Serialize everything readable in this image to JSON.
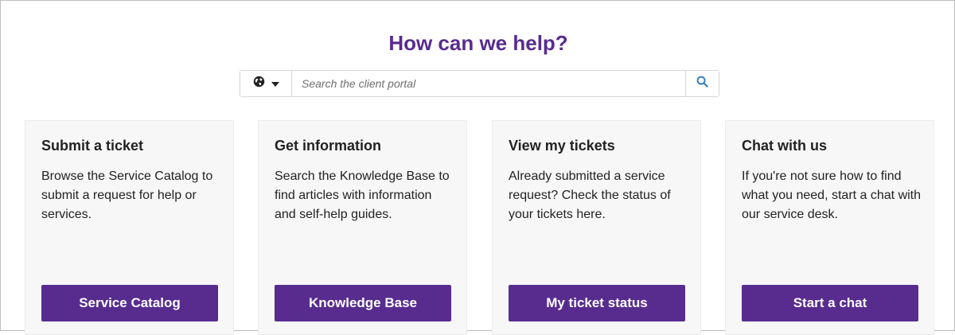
{
  "header": {
    "title": "How can we help?"
  },
  "search": {
    "placeholder": "Search the client portal",
    "language_icon": "globe-icon",
    "dropdown_icon": "caret-down-icon",
    "button_icon": "search-icon"
  },
  "cards": [
    {
      "title": "Submit a ticket",
      "description": "Browse the Service Catalog to submit a request for help or services.",
      "button_label": "Service Catalog"
    },
    {
      "title": "Get information",
      "description": "Search the Knowledge Base to find articles with information and self-help guides.",
      "button_label": "Knowledge Base"
    },
    {
      "title": "View my tickets",
      "description": "Already submitted a service request? Check the status of your tickets here.",
      "button_label": "My ticket status"
    },
    {
      "title": "Chat with us",
      "description": "If you're not sure how to find what you need, start a chat with our service desk.",
      "button_label": "Start a chat"
    }
  ],
  "colors": {
    "brand": "#582c8f",
    "card_bg": "#f7f7f7",
    "search_icon": "#2e77c2"
  }
}
